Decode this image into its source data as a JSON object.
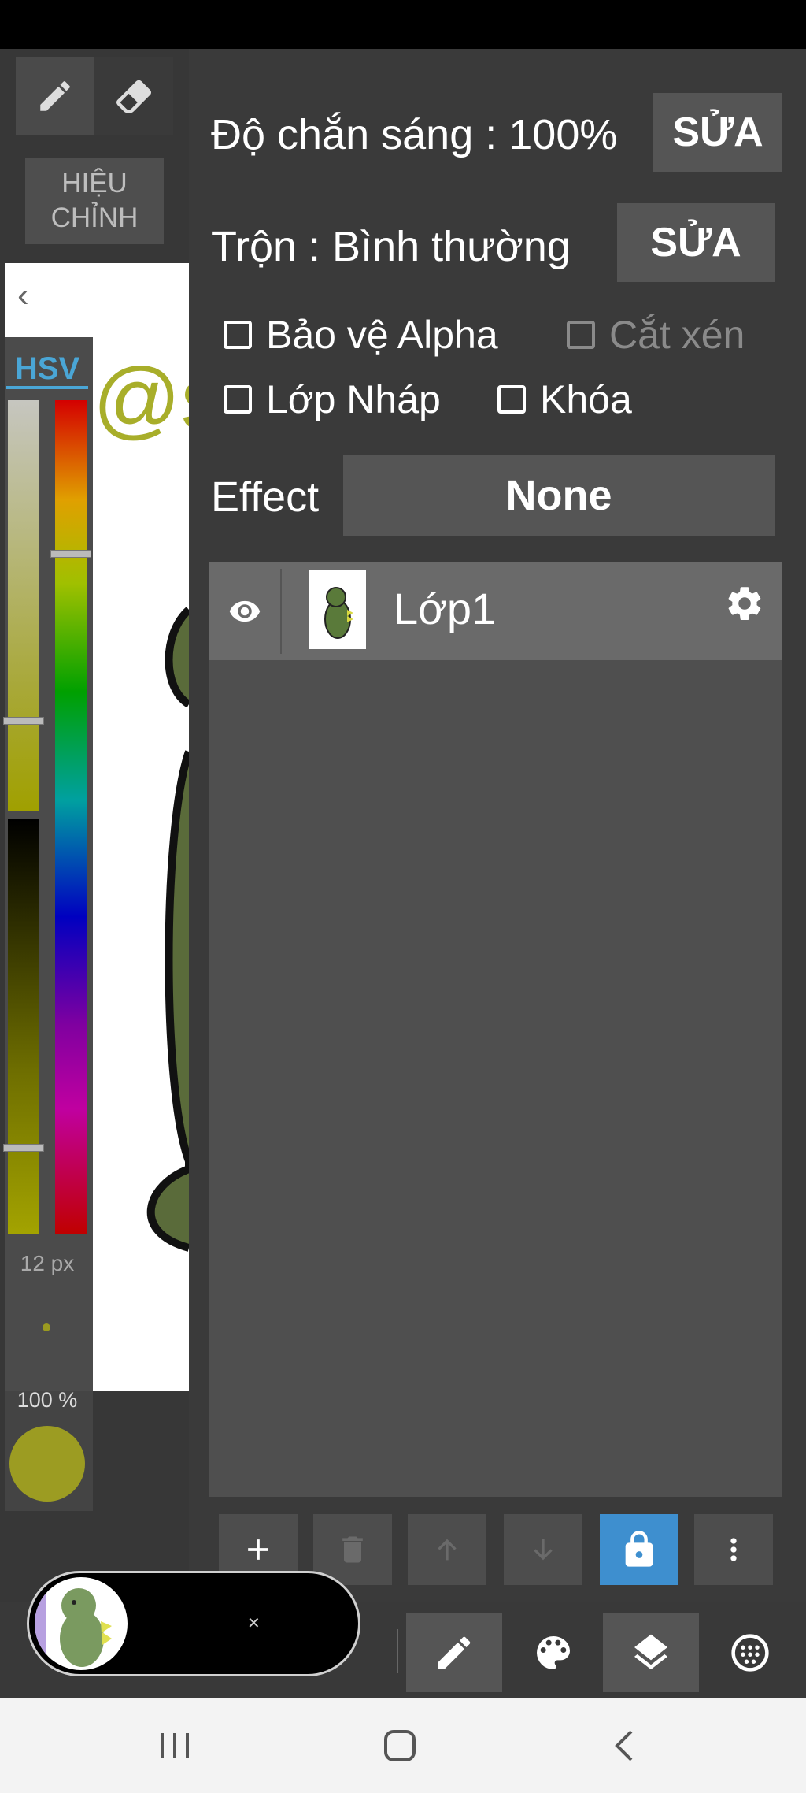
{
  "toolbar": {
    "pen_icon": "pencil-icon",
    "eraser_icon": "eraser-icon"
  },
  "adjust": {
    "line1": "HIỆU",
    "line2": "CHỈNH"
  },
  "color_panel": {
    "mode_label": "HSV",
    "brush_size": "12 px",
    "brush_opacity": "100 %",
    "current_color": "#9c9c22"
  },
  "layer_panel": {
    "opacity_label": "Độ chắn sáng",
    "opacity_value": "100%",
    "edit_label": "SỬA",
    "blend_label": "Trộn",
    "blend_value": "Bình thường",
    "checkboxes": {
      "protect_alpha": "Bảo vệ Alpha",
      "clipping": "Cắt xén",
      "draft_layer": "Lớp Nháp",
      "lock": "Khóa"
    },
    "effect_label": "Effect",
    "effect_value": "None",
    "layers": [
      {
        "name": "Lớp1",
        "visible": true
      }
    ]
  },
  "layer_actions": [
    "add-icon",
    "trash-icon",
    "arrow-up-icon",
    "arrow-down-icon",
    "lock-icon",
    "more-vert-icon"
  ],
  "bottom_nav": [
    "pencil-icon",
    "palette-icon",
    "layers-icon",
    "globe-icon"
  ],
  "accent_color": "#3e8fcf"
}
